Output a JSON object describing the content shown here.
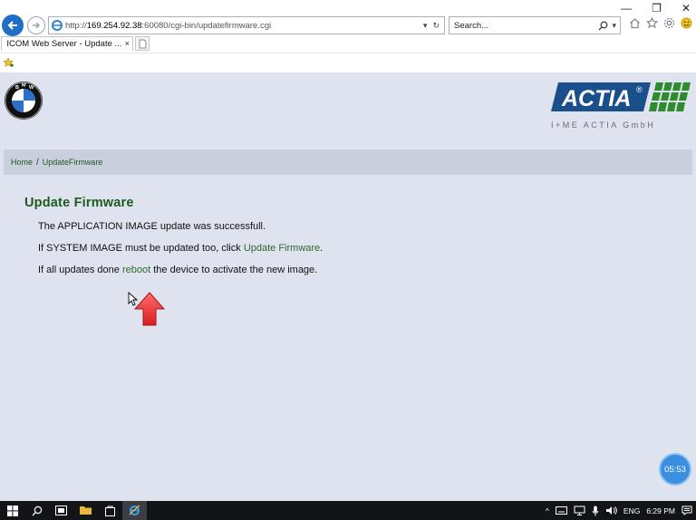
{
  "browser": {
    "url_prefix": "http://",
    "url_host": "169.254.92.38",
    "url_rest": ":60080/cgi-bin/updatefirmware.cgi",
    "search_placeholder": "Search...",
    "tab_title": "ICOM Web Server - Update ...",
    "tab_close": "×"
  },
  "header": {
    "bmw_letters": [
      "B",
      "M",
      "W"
    ],
    "actia_text": "ACTIA",
    "actia_registered": "®",
    "actia_subtitle": "I+ME ACTIA GmbH"
  },
  "breadcrumb": {
    "home": "Home",
    "separator": "/",
    "current": "UpdateFirmware"
  },
  "content": {
    "title": "Update Firmware",
    "line1": "The APPLICATION IMAGE update was successfull.",
    "line2_before": "If SYSTEM IMAGE must be updated too, click ",
    "line2_link": "Update Firmware",
    "line2_after": ".",
    "line3_before": "If all updates done ",
    "line3_link": "reboot",
    "line3_after": " the device to activate the new image."
  },
  "overlay": {
    "timer": "05:53"
  },
  "taskbar": {
    "language": "ENG",
    "time": "6:29 PM"
  },
  "colors": {
    "page_bg": "#dfe3ef",
    "title_green": "#1d5a1d",
    "link_green": "#2a6a2a",
    "actia_blue": "#1a4f8c",
    "actia_green": "#2e8b2e"
  }
}
